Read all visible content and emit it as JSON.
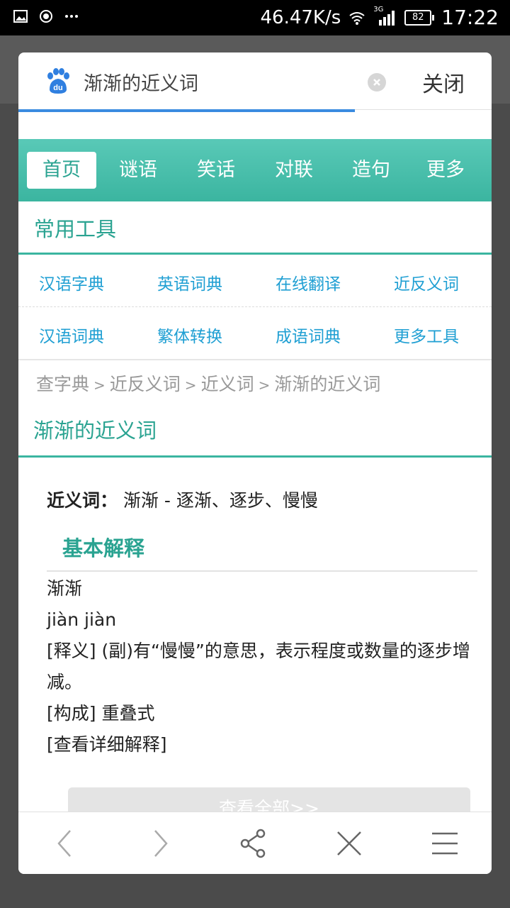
{
  "status_bar": {
    "speed": "46.47K/s",
    "network": "3G",
    "battery": "82",
    "time": "17:22"
  },
  "search": {
    "query": "渐渐的近义词",
    "close_label": "关闭"
  },
  "nav": {
    "tabs": [
      {
        "label": "首页",
        "active": true
      },
      {
        "label": "谜语"
      },
      {
        "label": "笑话"
      },
      {
        "label": "对联"
      },
      {
        "label": "造句"
      },
      {
        "label": "更多"
      }
    ]
  },
  "tools": {
    "title": "常用工具",
    "row1": [
      "汉语字典",
      "英语词典",
      "在线翻译",
      "近反义词"
    ],
    "row2": [
      "汉语词典",
      "繁体转换",
      "成语词典",
      "更多工具"
    ]
  },
  "breadcrumb": [
    "查字典",
    "近反义词",
    "近义词",
    "渐渐的近义词"
  ],
  "page": {
    "heading": "渐渐的近义词",
    "synonym_label": "近义词",
    "synonym_value": "渐渐 - 逐渐、逐步、慢慢",
    "sub_heading": "基本解释",
    "lines": [
      "渐渐",
      "jiàn jiàn",
      "[释义] (副)有“慢慢”的意思，表示程度或数量的逐步增减。",
      "[构成]  重叠式",
      "[查看详细解释]"
    ],
    "view_all": "查看全部>>"
  },
  "icons": {
    "back": "chevron-left-icon",
    "forward": "chevron-right-icon",
    "share": "share-icon",
    "close": "close-icon",
    "menu": "menu-icon"
  },
  "colors": {
    "accent": "#3bb5a0",
    "link": "#1f9fd3",
    "progress": "#3a8be0"
  }
}
